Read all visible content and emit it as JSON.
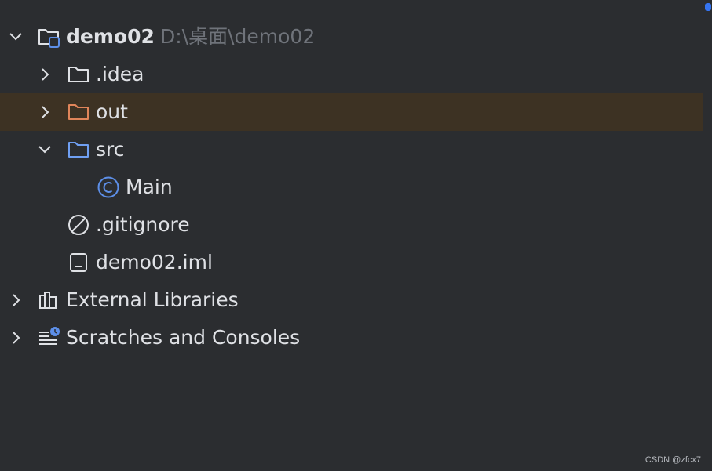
{
  "project": {
    "name": "demo02",
    "path": "D:\\桌面\\demo02"
  },
  "items": {
    "idea": ".idea",
    "out": "out",
    "src": "src",
    "main": "Main",
    "gitignore": ".gitignore",
    "iml": "demo02.iml",
    "external": "External Libraries",
    "scratches": "Scratches and Consoles"
  },
  "colors": {
    "background": "#2b2d30",
    "selected_row": "#43454a",
    "excluded_row": "#3d3223",
    "excluded_folder": "#e0855a",
    "source_folder": "#6f9ff2",
    "class_icon": "#5d8fe8",
    "muted_text": "#6f737a"
  },
  "watermark": "CSDN @zfcx7"
}
